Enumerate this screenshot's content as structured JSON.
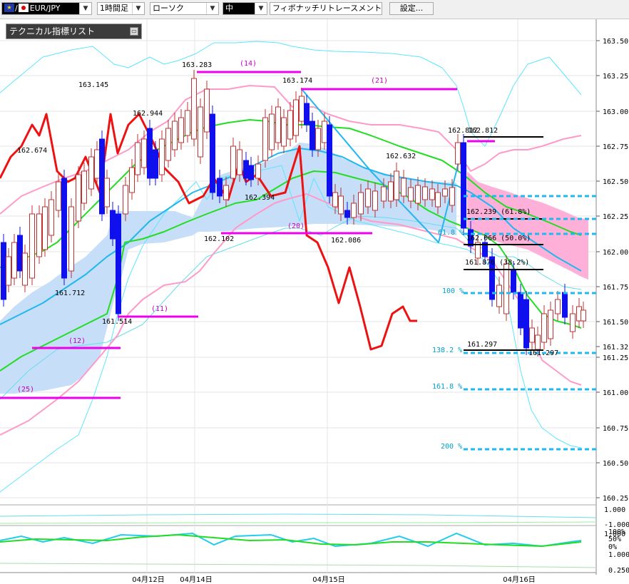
{
  "toolbar": {
    "pair": "EUR/JPY",
    "flag_slash": "/",
    "timeframe": "1時間足",
    "chart_type": "ローソク",
    "line_width": "中",
    "fibo_tool": "フィボナッチリトレースメント",
    "settings_label": "設定..."
  },
  "indicator_panel": {
    "title": "テクニカル指標リスト",
    "button_icon": "minimize-icon"
  },
  "price_axis": [
    "163.50",
    "163.25",
    "163.00",
    "162.75",
    "162.50",
    "162.25",
    "162.00",
    "161.75",
    "161.50",
    "161.32",
    "161.25",
    "161.00",
    "160.75",
    "160.50",
    "160.25"
  ],
  "osc_axis_1": [
    "1.000",
    "-1.000",
    "1.000"
  ],
  "osc_axis_2": [
    "100%",
    "50%",
    "0%",
    "1.000",
    "0.250"
  ],
  "time_axis": [
    "04月12日",
    "04月14日",
    "04月15日",
    "04月16日"
  ],
  "price_labels": [
    "162.674",
    "163.145",
    "162.944",
    "163.283",
    "163.174",
    "161.712",
    "161.514",
    "162.102",
    "162.394",
    "162.086",
    "162.632",
    "162.812",
    "161.297"
  ],
  "fib_labels": [
    "162.812",
    "162.239 (61.8%)",
    "162.066 (50.0%)",
    "161.876 (38.2%)",
    "161.297",
    "61.8 %",
    "100 %",
    "138.2 %",
    "161.8 %",
    "200 %"
  ],
  "count_labels": [
    "(14)",
    "(21)",
    "(20)",
    "(11)",
    "(12)",
    "(25)"
  ],
  "colors": {
    "up_candle": "#ff6060",
    "down_candle": "#1010ee",
    "spans_cloud": "#c6def7",
    "ichimoku_cloud": "#ffb0d8",
    "bb_outer": "#5ae6ff",
    "ma_green": "#22dd22",
    "ma_blue": "#22b7ee",
    "bb_pink": "#ff9ac8",
    "red_line": "#ee1111",
    "magenta": "#ee00ee",
    "fib_dash": "#22b8ee",
    "fib_solid": "#000000"
  }
}
